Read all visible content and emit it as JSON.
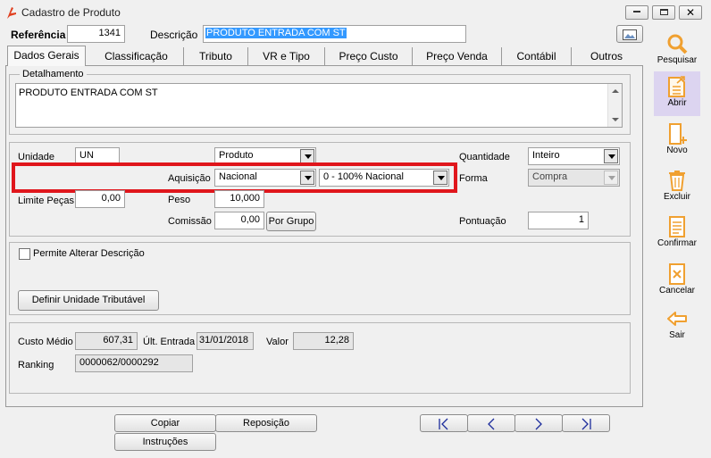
{
  "window": {
    "title": "Cadastro de Produto"
  },
  "header": {
    "ref_label": "Referência",
    "ref_value": "1341",
    "desc_label": "Descrição",
    "desc_value": "PRODUTO ENTRADA COM ST"
  },
  "tabs": [
    "Dados Gerais",
    "Classificação",
    "Tributo",
    "VR e Tipo",
    "Preço Custo",
    "Preço Venda",
    "Contábil",
    "Outros"
  ],
  "detail": {
    "legend": "Detalhamento",
    "text": "PRODUTO ENTRADA COM ST"
  },
  "fields": {
    "unidade_label": "Unidade",
    "unidade_value": "UN",
    "tipo_value": "Produto",
    "quantidade_label": "Quantidade",
    "quantidade_value": "Inteiro",
    "aquisicao_label": "Aquisição",
    "aquisicao_value": "Nacional",
    "origem_value": "0 - 100% Nacional",
    "forma_label": "Forma",
    "forma_value": "Compra",
    "limite_label": "Limite Peças",
    "limite_value": "0,00",
    "peso_label": "Peso",
    "peso_value": "10,000",
    "comissao_label": "Comissão",
    "comissao_value": "0,00",
    "por_grupo_label": "Por Grupo",
    "pontuacao_label": "Pontuação",
    "pontuacao_value": "1"
  },
  "options": {
    "permite_label": "Permite Alterar Descrição",
    "definir_label": "Definir Unidade Tributável"
  },
  "costs": {
    "custo_label": "Custo Médio",
    "custo_value": "607,31",
    "ult_label": "Últ. Entrada",
    "ult_value": "31/01/2018",
    "valor_label": "Valor",
    "valor_value": "12,28",
    "ranking_label": "Ranking",
    "ranking_value": "0000062/0000292"
  },
  "bottom": {
    "copiar": "Copiar",
    "reposicao": "Reposição",
    "instrucoes": "Instruções"
  },
  "sidebar": [
    "Pesquisar",
    "Abrir",
    "Novo",
    "Excluir",
    "Confirmar",
    "Cancelar",
    "Sair"
  ],
  "colors": {
    "highlight_box": "#e0161c",
    "selection": "#3399ff",
    "icon_orange": "#f0a030",
    "active_side": "#dcd4f0"
  }
}
